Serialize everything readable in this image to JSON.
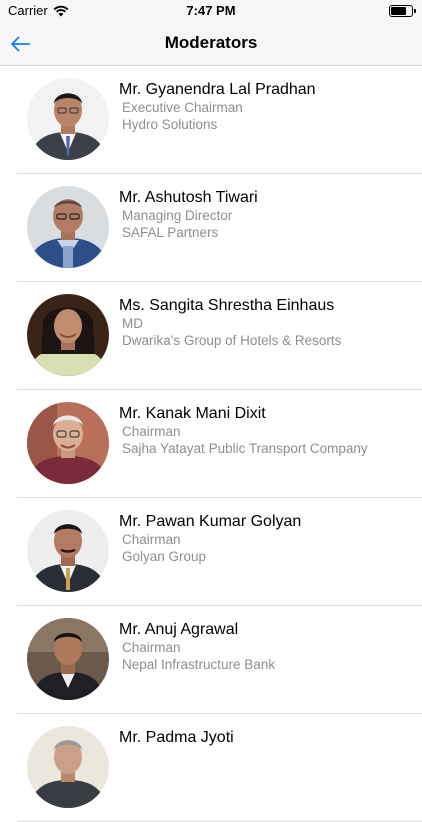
{
  "status_bar": {
    "carrier": "Carrier",
    "time": "7:47 PM"
  },
  "nav": {
    "title": "Moderators",
    "back_icon": "arrow-left-icon"
  },
  "colors": {
    "accent": "#1a7cf5",
    "secondary_text": "#8e8e93",
    "nav_background": "#f7f7f7"
  },
  "moderators": [
    {
      "name": "Mr. Gyanendra Lal Pradhan",
      "title": "Executive Chairman",
      "organization": "Hydro Solutions"
    },
    {
      "name": "Mr. Ashutosh Tiwari",
      "title": "Managing Director",
      "organization": "SAFAL Partners"
    },
    {
      "name": "Ms. Sangita Shrestha Einhaus",
      "title": "MD",
      "organization": "Dwarika's Group of Hotels & Resorts"
    },
    {
      "name": "Mr. Kanak Mani Dixit",
      "title": "Chairman",
      "organization": "Sajha Yatayat Public Transport Company"
    },
    {
      "name": "Mr. Pawan Kumar Golyan",
      "title": "Chairman",
      "organization": "Golyan Group"
    },
    {
      "name": "Mr. Anuj Agrawal",
      "title": "Chairman",
      "organization": "Nepal Infrastructure Bank"
    },
    {
      "name": "Mr. Padma Jyoti",
      "title": "",
      "organization": ""
    }
  ]
}
